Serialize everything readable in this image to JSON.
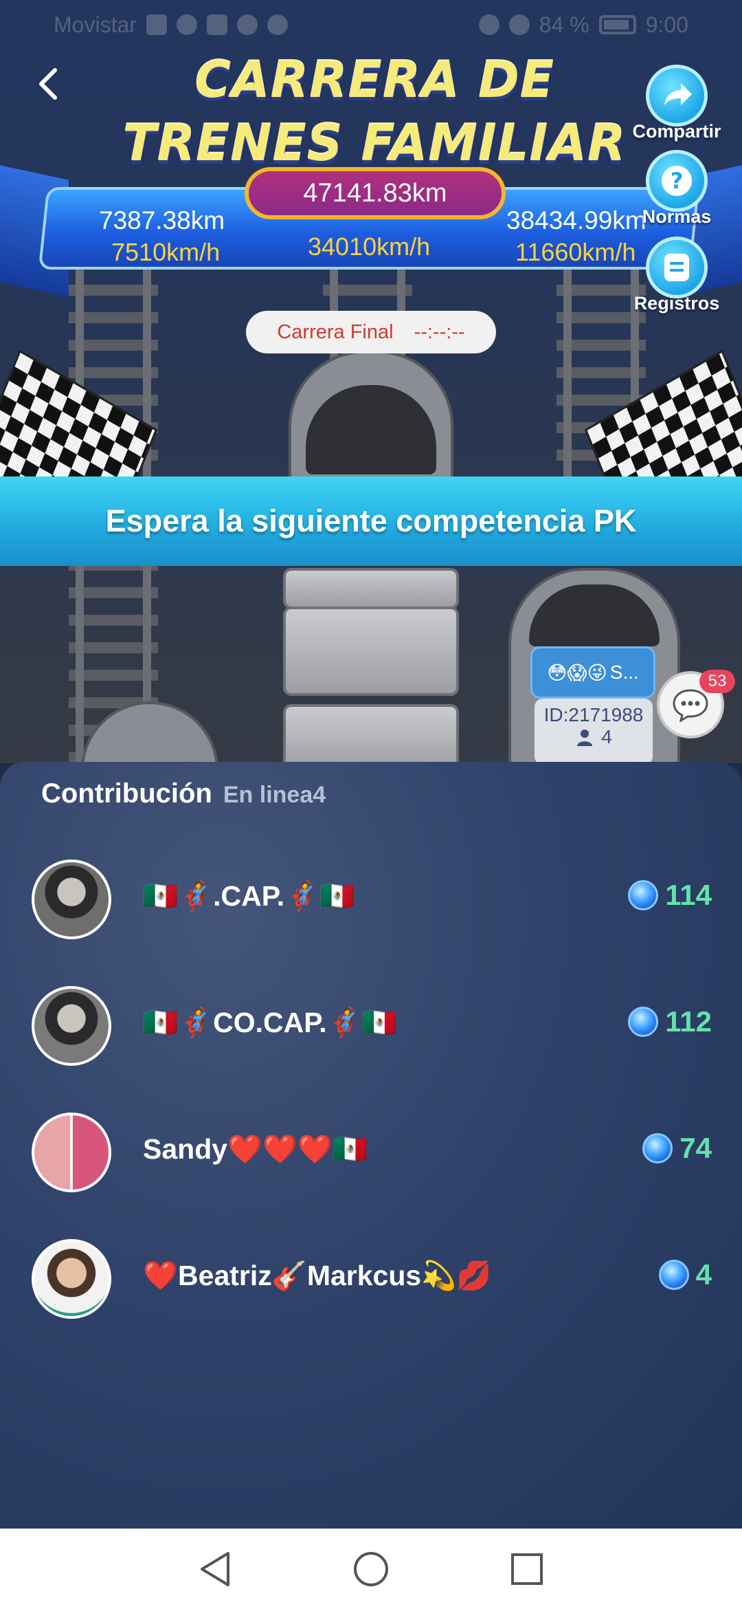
{
  "status_bar": {
    "carrier": "Movistar",
    "battery": "84 %",
    "time": "9:00"
  },
  "header": {
    "title_line1": "CARRERA DE",
    "title_line2": "TRENES FAMILIAR"
  },
  "race": {
    "total_distance": "47141.83km",
    "total_speed": "34010km/h",
    "left_distance": "7387.38km",
    "left_speed": "7510km/h",
    "right_distance": "38434.99km",
    "right_speed": "11660km/h",
    "final_label": "Carrera Final",
    "final_timer": "--:--:--",
    "banner": "Espera la siguiente competencia PK"
  },
  "side_buttons": {
    "share": "Compartir",
    "rules": "Normas",
    "records": "Registros"
  },
  "rival": {
    "emoji": "😳😱😜",
    "name": "S...",
    "id": "ID:2171988",
    "members": "4"
  },
  "chat": {
    "badge": "53"
  },
  "contribution": {
    "title": "Contribución",
    "online": "En linea4",
    "rows": [
      {
        "name": "🇲🇽🦸.CAP.🦸🇲🇽",
        "score": "114"
      },
      {
        "name": "🇲🇽🦸CO.CAP.🦸🇲🇽",
        "score": "112"
      },
      {
        "name": "Sandy❤️❤️❤️🇲🇽",
        "score": "74"
      },
      {
        "name": "❤️Beatriz🎸Markcus💫💋",
        "score": "4"
      }
    ]
  },
  "colors": {
    "banner": "#21a9de",
    "score_green": "#63e3ac",
    "speed_yellow": "#ffd23c",
    "pill_magenta": "#8a2b86"
  },
  "icons": [
    "back-arrow-icon",
    "share-icon",
    "question-icon",
    "records-icon",
    "chat-icon",
    "gem-icon",
    "nav-back-icon",
    "nav-home-icon",
    "nav-recents-icon"
  ]
}
